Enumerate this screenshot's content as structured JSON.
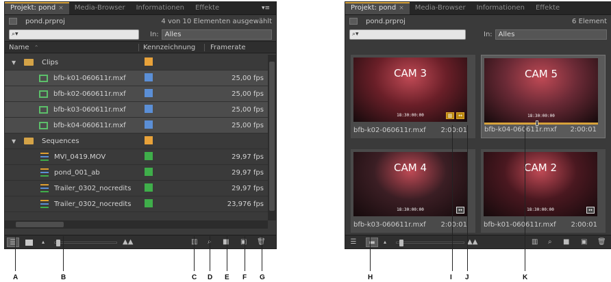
{
  "left_panel": {
    "tabs": [
      {
        "label": "Projekt: pond",
        "active": true,
        "closable": true
      },
      {
        "label": "Media-Browser",
        "active": false
      },
      {
        "label": "Informationen",
        "active": false
      },
      {
        "label": "Effekte",
        "active": false
      }
    ],
    "project_file": "pond.prproj",
    "item_count": "4 von 10 Elementen ausgewählt",
    "search_placeholder": "",
    "in_label": "In:",
    "in_value": "Alles",
    "columns": {
      "name": "Name",
      "label": "Kennzeichnung",
      "framerate": "Framerate"
    },
    "rows": [
      {
        "type": "bin",
        "name": "Clips",
        "color": "#e8a23a",
        "fps": ""
      },
      {
        "type": "clip",
        "name": "bfb-k01-060611r.mxf",
        "color": "#5b8fd6",
        "fps": "25,00 fps"
      },
      {
        "type": "clip",
        "name": "bfb-k02-060611r.mxf",
        "color": "#5b8fd6",
        "fps": "25,00 fps"
      },
      {
        "type": "clip",
        "name": "bfb-k03-060611r.mxf",
        "color": "#5b8fd6",
        "fps": "25,00 fps"
      },
      {
        "type": "clip",
        "name": "bfb-k04-060611r.mxf",
        "color": "#5b8fd6",
        "fps": "25,00 fps"
      },
      {
        "type": "bin",
        "name": "Sequences",
        "color": "#e8a23a",
        "fps": ""
      },
      {
        "type": "seq",
        "name": "MVI_0419.MOV",
        "color": "#3fae4a",
        "fps": "29,97 fps"
      },
      {
        "type": "seq",
        "name": "pond_001_ab",
        "color": "#3fae4a",
        "fps": "29,97 fps"
      },
      {
        "type": "seq",
        "name": "Trailer_0302_nocredits",
        "color": "#3fae4a",
        "fps": "29,97 fps"
      },
      {
        "type": "seq",
        "name": "Trailer_0302_nocredits",
        "color": "#3fae4a",
        "fps": "23,976 fps"
      }
    ]
  },
  "right_panel": {
    "tabs": [
      {
        "label": "Projekt: pond",
        "active": true,
        "closable": true
      },
      {
        "label": "Media-Browser",
        "active": false
      },
      {
        "label": "Informationen",
        "active": false
      },
      {
        "label": "Effekte",
        "active": false
      }
    ],
    "project_file": "pond.prproj",
    "item_count": "6 Element",
    "in_label": "In:",
    "in_value": "Alles",
    "clips": [
      {
        "cam": "CAM 3",
        "name": "bfb-k02-060611r.mxf",
        "duration": "2:00:01",
        "timecode": "18:30:00:00",
        "selected": false,
        "bg": "#6a1f28",
        "badges": [
          "gold",
          "gold"
        ]
      },
      {
        "cam": "CAM 5",
        "name": "bfb-k04-060611r.mxf",
        "duration": "2:00:01",
        "timecode": "18:30:00:00",
        "selected": true,
        "bg": "#6b2a36",
        "badges": [],
        "scrub": 0.45
      },
      {
        "cam": "CAM 4",
        "name": "bfb-k03-060611r.mxf",
        "duration": "2:00:01",
        "timecode": "18:30:00:00",
        "selected": false,
        "bg": "#3b1e24",
        "badges": [
          "plain"
        ]
      },
      {
        "cam": "CAM 2",
        "name": "bfb-k01-060611r.mxf",
        "duration": "2:00:01",
        "timecode": "18:30:00:00",
        "selected": false,
        "bg": "#4a1820",
        "badges": [
          "plain"
        ]
      }
    ]
  },
  "callouts": [
    "A",
    "B",
    "C",
    "D",
    "E",
    "F",
    "G",
    "H",
    "I",
    "J",
    "K"
  ],
  "icons": {
    "list_view": "list-view-icon",
    "icon_view": "icon-view-icon",
    "zoom_small": "mountain-small-icon",
    "zoom_large": "mountain-large-icon",
    "auto_sequence": "automate-to-sequence-icon",
    "find": "search-icon",
    "new_bin": "folder-icon",
    "new_item": "new-item-icon",
    "clear": "trash-icon"
  }
}
